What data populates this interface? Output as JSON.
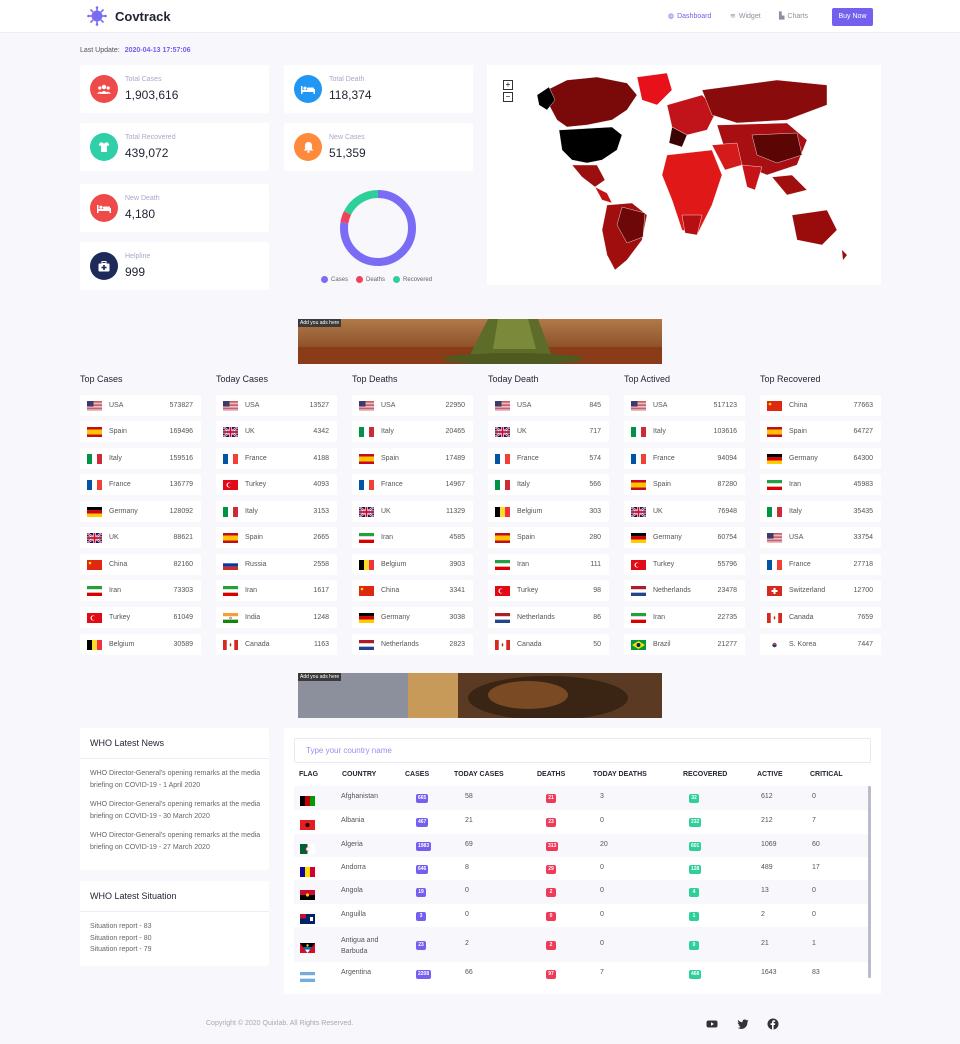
{
  "header": {
    "brand": "Covtrack",
    "nav": [
      {
        "label": "Dashboard",
        "icon": "dashboard-icon"
      },
      {
        "label": "Widget",
        "icon": "layers-icon"
      },
      {
        "label": "Charts",
        "icon": "bar-chart-icon"
      }
    ],
    "buy_label": "Buy Now"
  },
  "last_update": {
    "label": "Last Update:",
    "value": "2020-04-13 17:57:06"
  },
  "stats": {
    "total_cases": {
      "label": "Total Cases",
      "value": "1,903,616",
      "color": "#ef4a4a",
      "icon": "users-icon"
    },
    "total_death": {
      "label": "Total Death",
      "value": "118,374",
      "color": "#2196f3",
      "icon": "bed-icon"
    },
    "total_recovered": {
      "label": "Total Recovered",
      "value": "439,072",
      "color": "#2fcfa8",
      "icon": "shirt-icon"
    },
    "new_cases": {
      "label": "New Cases",
      "value": "51,359",
      "color": "#ff8a3c",
      "icon": "bell-icon"
    },
    "new_death": {
      "label": "New Death",
      "value": "4,180",
      "color": "#ef4a4a",
      "icon": "bed-icon"
    },
    "helpline": {
      "label": "Helpline",
      "value": "999",
      "color": "#1c2b5a",
      "icon": "medkit-icon"
    }
  },
  "chart_data": {
    "type": "pie",
    "categories": [
      "Cases",
      "Deaths",
      "Recovered"
    ],
    "values": [
      1903616,
      118374,
      439072
    ],
    "colors": [
      "#7b6cf6",
      "#f0425a",
      "#2fcf9a"
    ],
    "legend": "bottom"
  },
  "map": {
    "zoom_in": "+",
    "zoom_out": "−"
  },
  "ads": {
    "tag": "Add you ads here"
  },
  "top_lists": [
    {
      "title": "Top Cases",
      "rows": [
        {
          "country": "USA",
          "value": "573827",
          "flag": "us"
        },
        {
          "country": "Spain",
          "value": "169496",
          "flag": "es"
        },
        {
          "country": "Italy",
          "value": "159516",
          "flag": "it"
        },
        {
          "country": "France",
          "value": "136779",
          "flag": "fr"
        },
        {
          "country": "Germany",
          "value": "128092",
          "flag": "de"
        },
        {
          "country": "UK",
          "value": "88621",
          "flag": "gb"
        },
        {
          "country": "China",
          "value": "82160",
          "flag": "cn"
        },
        {
          "country": "Iran",
          "value": "73303",
          "flag": "ir"
        },
        {
          "country": "Turkey",
          "value": "61049",
          "flag": "tr"
        },
        {
          "country": "Belgium",
          "value": "30589",
          "flag": "be"
        }
      ]
    },
    {
      "title": "Today Cases",
      "rows": [
        {
          "country": "USA",
          "value": "13527",
          "flag": "us"
        },
        {
          "country": "UK",
          "value": "4342",
          "flag": "gb"
        },
        {
          "country": "France",
          "value": "4188",
          "flag": "fr"
        },
        {
          "country": "Turkey",
          "value": "4093",
          "flag": "tr"
        },
        {
          "country": "Italy",
          "value": "3153",
          "flag": "it"
        },
        {
          "country": "Spain",
          "value": "2665",
          "flag": "es"
        },
        {
          "country": "Russia",
          "value": "2558",
          "flag": "ru"
        },
        {
          "country": "Iran",
          "value": "1617",
          "flag": "ir"
        },
        {
          "country": "India",
          "value": "1248",
          "flag": "in"
        },
        {
          "country": "Canada",
          "value": "1163",
          "flag": "ca"
        }
      ]
    },
    {
      "title": "Top Deaths",
      "rows": [
        {
          "country": "USA",
          "value": "22950",
          "flag": "us"
        },
        {
          "country": "Italy",
          "value": "20465",
          "flag": "it"
        },
        {
          "country": "Spain",
          "value": "17489",
          "flag": "es"
        },
        {
          "country": "France",
          "value": "14967",
          "flag": "fr"
        },
        {
          "country": "UK",
          "value": "11329",
          "flag": "gb"
        },
        {
          "country": "Iran",
          "value": "4585",
          "flag": "ir"
        },
        {
          "country": "Belgium",
          "value": "3903",
          "flag": "be"
        },
        {
          "country": "China",
          "value": "3341",
          "flag": "cn"
        },
        {
          "country": "Germany",
          "value": "3038",
          "flag": "de"
        },
        {
          "country": "Netherlands",
          "value": "2823",
          "flag": "nl"
        }
      ]
    },
    {
      "title": "Today Death",
      "rows": [
        {
          "country": "USA",
          "value": "845",
          "flag": "us"
        },
        {
          "country": "UK",
          "value": "717",
          "flag": "gb"
        },
        {
          "country": "France",
          "value": "574",
          "flag": "fr"
        },
        {
          "country": "Italy",
          "value": "566",
          "flag": "it"
        },
        {
          "country": "Belgium",
          "value": "303",
          "flag": "be"
        },
        {
          "country": "Spain",
          "value": "280",
          "flag": "es"
        },
        {
          "country": "Iran",
          "value": "111",
          "flag": "ir"
        },
        {
          "country": "Turkey",
          "value": "98",
          "flag": "tr"
        },
        {
          "country": "Netherlands",
          "value": "86",
          "flag": "nl"
        },
        {
          "country": "Canada",
          "value": "50",
          "flag": "ca"
        }
      ]
    },
    {
      "title": "Top Actived",
      "rows": [
        {
          "country": "USA",
          "value": "517123",
          "flag": "us"
        },
        {
          "country": "Italy",
          "value": "103616",
          "flag": "it"
        },
        {
          "country": "France",
          "value": "94094",
          "flag": "fr"
        },
        {
          "country": "Spain",
          "value": "87280",
          "flag": "es"
        },
        {
          "country": "UK",
          "value": "76948",
          "flag": "gb"
        },
        {
          "country": "Germany",
          "value": "60754",
          "flag": "de"
        },
        {
          "country": "Turkey",
          "value": "55796",
          "flag": "tr"
        },
        {
          "country": "Netherlands",
          "value": "23478",
          "flag": "nl"
        },
        {
          "country": "Iran",
          "value": "22735",
          "flag": "ir"
        },
        {
          "country": "Brazil",
          "value": "21277",
          "flag": "br"
        }
      ]
    },
    {
      "title": "Top Recovered",
      "rows": [
        {
          "country": "China",
          "value": "77663",
          "flag": "cn"
        },
        {
          "country": "Spain",
          "value": "64727",
          "flag": "es"
        },
        {
          "country": "Germany",
          "value": "64300",
          "flag": "de"
        },
        {
          "country": "Iran",
          "value": "45983",
          "flag": "ir"
        },
        {
          "country": "Italy",
          "value": "35435",
          "flag": "it"
        },
        {
          "country": "USA",
          "value": "33754",
          "flag": "us"
        },
        {
          "country": "France",
          "value": "27718",
          "flag": "fr"
        },
        {
          "country": "Switzerland",
          "value": "12700",
          "flag": "ch"
        },
        {
          "country": "Canada",
          "value": "7659",
          "flag": "ca"
        },
        {
          "country": "S. Korea",
          "value": "7447",
          "flag": "kr"
        }
      ]
    }
  ],
  "news": {
    "title": "WHO Latest News",
    "items": [
      "WHO Director-General's opening remarks at the media briefing on COVID-19 - 1 April 2020",
      "WHO Director-General's opening remarks at the media briefing on COVID-19 - 30 March 2020",
      "WHO Director-General's opening remarks at the media briefing on COVID-19 - 27 March 2020"
    ]
  },
  "situation": {
    "title": "WHO Latest Situation",
    "items": [
      "Situation report - 83",
      "Situation report - 80",
      "Situation report - 79"
    ]
  },
  "table": {
    "search_placeholder": "Type your country name",
    "headers": [
      "FLAG",
      "COUNTRY",
      "CASES",
      "TODAY CASES",
      "DEATHS",
      "TODAY DEATHS",
      "RECOVERED",
      "ACTIVE",
      "CRITICAL"
    ],
    "rows": [
      {
        "flag": "af",
        "country": "Afghanistan",
        "cases": "665",
        "today_cases": "58",
        "deaths": "21",
        "today_deaths": "3",
        "recovered": "32",
        "active": "612",
        "critical": "0"
      },
      {
        "flag": "al",
        "country": "Albania",
        "cases": "467",
        "today_cases": "21",
        "deaths": "23",
        "today_deaths": "0",
        "recovered": "232",
        "active": "212",
        "critical": "7"
      },
      {
        "flag": "dz",
        "country": "Algeria",
        "cases": "1983",
        "today_cases": "69",
        "deaths": "313",
        "today_deaths": "20",
        "recovered": "601",
        "active": "1069",
        "critical": "60"
      },
      {
        "flag": "ad",
        "country": "Andorra",
        "cases": "646",
        "today_cases": "8",
        "deaths": "29",
        "today_deaths": "0",
        "recovered": "128",
        "active": "489",
        "critical": "17"
      },
      {
        "flag": "ao",
        "country": "Angola",
        "cases": "19",
        "today_cases": "0",
        "deaths": "2",
        "today_deaths": "0",
        "recovered": "4",
        "active": "13",
        "critical": "0"
      },
      {
        "flag": "ai",
        "country": "Anguilla",
        "cases": "3",
        "today_cases": "0",
        "deaths": "0",
        "today_deaths": "0",
        "recovered": "1",
        "active": "2",
        "critical": "0"
      },
      {
        "flag": "ag",
        "country": "Antigua and Barbuda",
        "cases": "23",
        "today_cases": "2",
        "deaths": "2",
        "today_deaths": "0",
        "recovered": "0",
        "active": "21",
        "critical": "1"
      },
      {
        "flag": "ar",
        "country": "Argentina",
        "cases": "2208",
        "today_cases": "66",
        "deaths": "97",
        "today_deaths": "7",
        "recovered": "468",
        "active": "1643",
        "critical": "83"
      }
    ]
  },
  "footer": {
    "copyright": "Copyright © 2020 Quixlab. All Rights Reserved."
  },
  "social": [
    "youtube-icon",
    "twitter-icon",
    "facebook-icon"
  ]
}
